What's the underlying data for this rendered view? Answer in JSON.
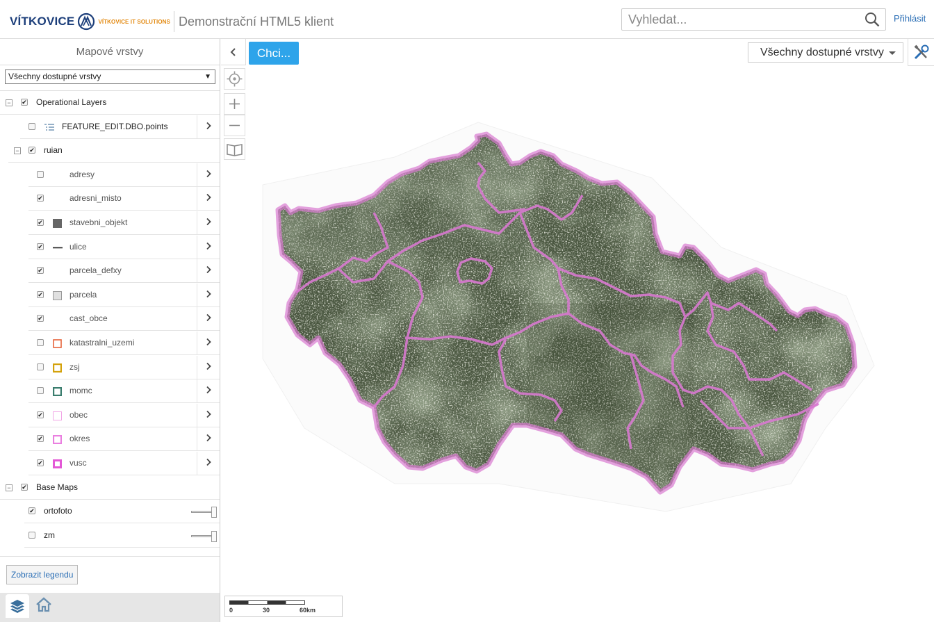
{
  "header": {
    "logo_text": "VÍTKOVICE",
    "logo_sub": "VÍTKOVICE IT SOLUTIONS",
    "app_title": "Demonstrační HTML5 klient",
    "search_placeholder": "Vyhledat...",
    "login_label": "Přihlásit"
  },
  "sidebar": {
    "title": "Mapové vrstvy",
    "layer_filter": "Všechny dostupné vrstvy",
    "tree": [
      {
        "label": "Operational Layers",
        "checked": true,
        "type": "group"
      },
      {
        "label": "FEATURE_EDIT.DBO.points",
        "checked": false,
        "type": "layer",
        "symbol": "list-icon"
      },
      {
        "label": "ruian",
        "checked": true,
        "type": "group"
      },
      {
        "label": "adresy",
        "checked": false,
        "type": "sublayer",
        "symbol": "none"
      },
      {
        "label": "adresni_misto",
        "checked": true,
        "type": "sublayer",
        "symbol": "none"
      },
      {
        "label": "stavebni_objekt",
        "checked": true,
        "type": "sublayer",
        "symbol": "fill-gray"
      },
      {
        "label": "ulice",
        "checked": true,
        "type": "sublayer",
        "symbol": "line-black"
      },
      {
        "label": "parcela_defxy",
        "checked": true,
        "type": "sublayer",
        "symbol": "none"
      },
      {
        "label": "parcela",
        "checked": true,
        "type": "sublayer",
        "symbol": "box-lightgray"
      },
      {
        "label": "cast_obce",
        "checked": true,
        "type": "sublayer",
        "symbol": "none"
      },
      {
        "label": "katastralni_uzemi",
        "checked": false,
        "type": "sublayer",
        "symbol": "box-orange"
      },
      {
        "label": "zsj",
        "checked": false,
        "type": "sublayer",
        "symbol": "box-gold"
      },
      {
        "label": "momc",
        "checked": false,
        "type": "sublayer",
        "symbol": "box-green"
      },
      {
        "label": "obec",
        "checked": true,
        "type": "sublayer",
        "symbol": "box-pink-thin"
      },
      {
        "label": "okres",
        "checked": true,
        "type": "sublayer",
        "symbol": "box-pink"
      },
      {
        "label": "vusc",
        "checked": true,
        "type": "sublayer",
        "symbol": "box-magenta"
      },
      {
        "label": "Base Maps",
        "checked": true,
        "type": "group"
      },
      {
        "label": "ortofoto",
        "checked": true,
        "type": "basemap"
      },
      {
        "label": "zm",
        "checked": false,
        "type": "basemap"
      }
    ],
    "legend_button": "Zobrazit legendu"
  },
  "map": {
    "hint_button": "Chci...",
    "layers_dropdown": "Všechny dostupné vrstvy",
    "scale_labels": [
      "0",
      "30",
      "60km"
    ],
    "boundary_color": "#d879d0",
    "terrain_color": "#4a5740"
  },
  "icons": {
    "search": "search-icon",
    "collapse": "chevron-left-icon",
    "locate": "locate-icon",
    "zoom_in": "plus-icon",
    "zoom_out": "minus-icon",
    "bookmarks": "book-icon",
    "tools": "tools-icon",
    "layers_tab": "layers-icon",
    "home_tab": "home-icon"
  }
}
